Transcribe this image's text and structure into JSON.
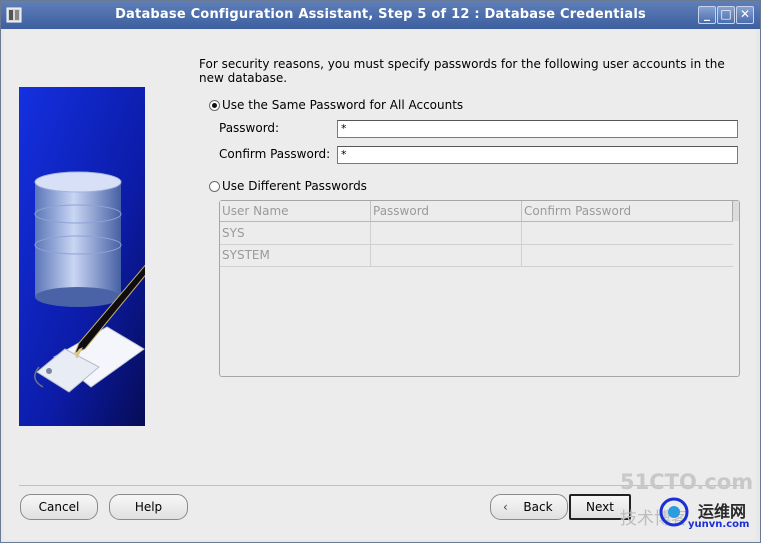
{
  "window": {
    "title": "Database Configuration Assistant, Step 5 of 12 : Database Credentials"
  },
  "intro_text": "For security reasons, you must specify passwords for the following user accounts in the new database.",
  "same_password": {
    "option_label": "Use the Same Password for All Accounts",
    "password_label": "Password:",
    "password_value": "*",
    "confirm_label": "Confirm Password:",
    "confirm_value": "*"
  },
  "different_passwords": {
    "option_label": "Use Different Passwords",
    "columns": [
      "User Name",
      "Password",
      "Confirm Password"
    ],
    "rows": [
      {
        "user": "SYS",
        "password": "",
        "confirm": ""
      },
      {
        "user": "SYSTEM",
        "password": "",
        "confirm": ""
      }
    ]
  },
  "buttons": {
    "cancel": "Cancel",
    "help": "Help",
    "back": "Back",
    "next": "Next"
  },
  "watermark": {
    "line1": "51CTO.com",
    "line2_cn": "技术博客",
    "line2_b": "运维网",
    "line3": "yunvn.com"
  },
  "colors": {
    "title_bar": "#4a6aa8",
    "accent_blue": "#1a2fd6"
  }
}
